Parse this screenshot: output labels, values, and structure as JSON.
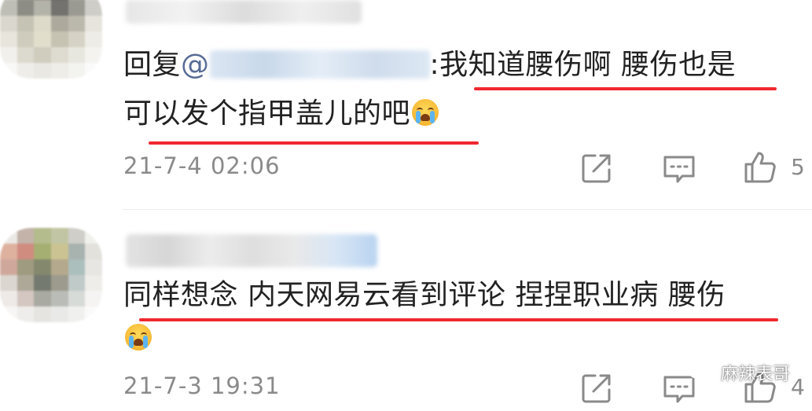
{
  "comments": [
    {
      "reply_prefix": "回复",
      "mention_symbol": "@",
      "text_line1": ":我知道腰伤啊 腰伤也是",
      "text_line2": "可以发个指甲盖儿的吧",
      "emoji": "crying-face",
      "timestamp": "21-7-4 02:06",
      "like_count": "5"
    },
    {
      "text_line1": "同样想念 内天网易云看到评论 捏捏职业病 腰伤",
      "emoji": "crying-face",
      "timestamp": "21-7-3 19:31",
      "like_count": "4"
    }
  ],
  "icons": {
    "share": "share-icon",
    "reply": "comment-icon",
    "like": "thumbs-up-icon"
  },
  "watermark": {
    "text": "麻辣表哥",
    "icon": "wechat-icon"
  },
  "colors": {
    "text": "#222222",
    "mention": "#576b95",
    "meta": "#8a8a8a",
    "underline": "#f0292e"
  }
}
